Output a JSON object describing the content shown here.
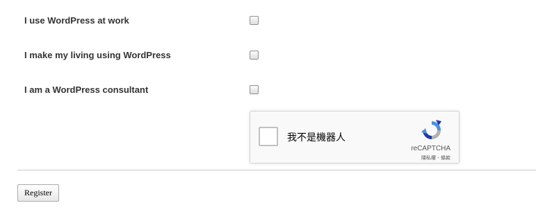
{
  "form": {
    "questions": [
      {
        "label": "I use WordPress at work",
        "checked": false
      },
      {
        "label": "I make my living using WordPress",
        "checked": false
      },
      {
        "label": "I am a WordPress consultant",
        "checked": false
      }
    ]
  },
  "recaptcha": {
    "label": "我不是機器人",
    "brand": "reCAPTCHA",
    "privacy_link": "隱私權",
    "separator": " - ",
    "terms_link": "條款",
    "logo_colors": {
      "blue": "#4a90e2",
      "dark_blue": "#1c3aa9",
      "grey": "#b0b0b0"
    }
  },
  "actions": {
    "register_label": "Register"
  }
}
